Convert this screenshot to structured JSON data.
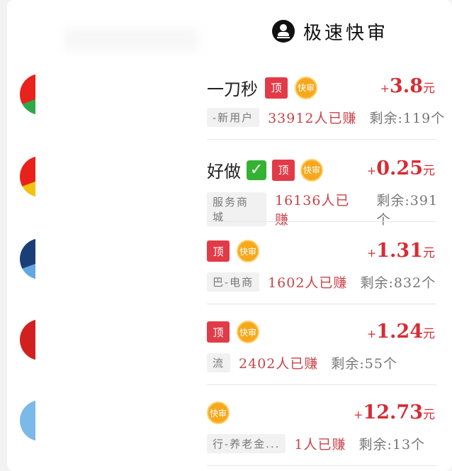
{
  "header": {
    "title": "极速快审",
    "icon": "user-stamp-icon"
  },
  "badges": {
    "top_label": "顶",
    "fast_label": "快审"
  },
  "tasks": [
    {
      "title": "一刀秒",
      "check": false,
      "show_top": true,
      "show_fast": true,
      "price_plus": "+",
      "price": "3.8",
      "price_unit": "元",
      "tag": "-新用户",
      "earned": "33912人已赚",
      "remaining": "剩余:119个",
      "avatar_colors": [
        "#e8221c",
        "#2fa84a"
      ]
    },
    {
      "title": "好做",
      "check": true,
      "show_top": true,
      "show_fast": true,
      "price_plus": "+",
      "price": "0.25",
      "price_unit": "元",
      "tag": "服务商城",
      "earned": "16136人已赚",
      "remaining": "剩余:391个",
      "avatar_colors": [
        "#e8211b",
        "#f5c20f"
      ]
    },
    {
      "title": "",
      "check": false,
      "show_top": true,
      "show_fast": true,
      "price_plus": "+",
      "price": "1.31",
      "price_unit": "元",
      "tag": "巴-电商",
      "earned": "1602人已赚",
      "remaining": "剩余:832个",
      "avatar_colors": [
        "#1a3f78",
        "#63a8e0"
      ]
    },
    {
      "title": "",
      "check": false,
      "show_top": true,
      "show_fast": true,
      "price_plus": "+",
      "price": "1.24",
      "price_unit": "元",
      "tag": "流",
      "earned": "2402人已赚",
      "remaining": "剩余:55个",
      "avatar_colors": [
        "#d21f1f",
        "#d21f1f"
      ]
    },
    {
      "title": "",
      "check": false,
      "show_top": false,
      "show_fast": true,
      "price_plus": "+",
      "price": "12.73",
      "price_unit": "元",
      "tag": "行-养老金...",
      "earned": "1人已赚",
      "remaining": "剩余:13个",
      "avatar_colors": [
        "#7bb9e8",
        "#7bb9e8"
      ]
    }
  ]
}
